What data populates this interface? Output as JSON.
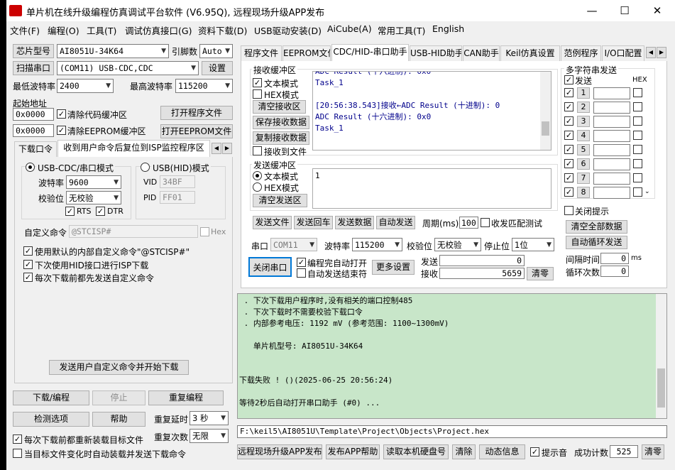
{
  "title": "单片机在线升级编程仿真调试平台软件 (V6.95Q), 远程现场升级APP发布",
  "menu": [
    "文件(F)",
    "编程(O)",
    "工具(T)",
    "调试仿真接口(G)",
    "资料下载(D)",
    "USB驱动安装(D)",
    "AiCube(A)",
    "常用工具(T)",
    "English"
  ],
  "left": {
    "chip_btn": "芯片型号",
    "chip_value": "AI8051U-34K64",
    "pins_label": "引脚数",
    "pins_value": "Auto",
    "scan_btn": "扫描串口",
    "port_value": "(COM11) USB-CDC,CDC",
    "settings_btn": "设置",
    "min_baud_label": "最低波特率",
    "min_baud_value": "2400",
    "max_baud_label": "最高波特率",
    "max_baud_value": "115200",
    "start_addr_label": "起始地址",
    "addr1": "0x0000",
    "clear_code": "清除代码缓冲区",
    "open_prog_btn": "打开程序文件",
    "addr2": "0x0000",
    "clear_eeprom": "清除EEPROM缓冲区",
    "open_eeprom_btn": "打开EEPROM文件",
    "tab1": "下载口令",
    "tab2": "收到用户命令后复位到ISP监控程序区",
    "usb_cdc_mode": "USB-CDC/串口模式",
    "usb_hid_mode": "USB(HID)模式",
    "baud_label": "波特率",
    "baud_value": "9600",
    "parity_label": "校验位",
    "parity_value": "无校验",
    "vid_label": "VID",
    "vid_value": "34BF",
    "pid_label": "PID",
    "pid_value": "FF01",
    "rts": "RTS",
    "dtr": "DTR",
    "custom_cmd_label": "自定义命令",
    "custom_cmd_value": "@STCISP#",
    "hex": "Hex",
    "opt1": "使用默认的内部自定义命令\"@STCISP#\"",
    "opt2": "下次使用HID接口进行ISP下载",
    "opt3": "每次下载前都先发送自定义命令",
    "send_custom_btn": "发送用户自定义命令并开始下载",
    "download_btn": "下载/编程",
    "stop_btn": "停止",
    "reprogram_btn": "重复编程",
    "check_btn": "检测选项",
    "help_btn": "帮助",
    "repeat_delay_label": "重复延时",
    "repeat_delay_value": "3 秒",
    "repeat_count_label": "重复次数",
    "repeat_count_value": "无限",
    "reload_opt": "每次下载前都重新装载目标文件",
    "auto_load_opt": "当目标文件变化时自动装载并发送下载命令"
  },
  "right": {
    "tabs": [
      "程序文件",
      "EEPROM文件",
      "CDC/HID-串口助手",
      "USB-HID助手",
      "CAN助手",
      "Keil仿真设置",
      "范例程序",
      "I/O口配置"
    ],
    "rx_group": "接收缓冲区",
    "rx_text_mode": "文本模式",
    "rx_hex_mode": "HEX模式",
    "clear_rx_btn": "清空接收区",
    "save_rx_btn": "保存接收数据",
    "copy_rx_btn": "复制接收数据",
    "rx_to_file": "接收到文件",
    "rx_lines": [
      "ADC Result (十六进制): 0x0",
      "Task_1",
      "",
      "[20:56:38.543]接收←ADC Result (十进制): 0",
      "ADC Result (十六进制): 0x0",
      "Task_1"
    ],
    "tx_group": "发送缓冲区",
    "tx_text_mode": "文本模式",
    "tx_hex_mode": "HEX模式",
    "clear_tx_btn": "清空发送区",
    "tx_content": "1",
    "send_file_btn": "发送文件",
    "send_enter_btn": "发送回车",
    "send_data_btn": "发送数据",
    "auto_send_btn": "自动发送",
    "period_label": "周期(ms)",
    "period_value": "100",
    "match_test": "收发匹配测试",
    "port_label": "串口",
    "port_value": "COM11",
    "baud_label": "波特率",
    "baud_value": "115200",
    "parity_label": "校验位",
    "parity_value": "无校验",
    "stop_label": "停止位",
    "stop_value": "1位",
    "close_port_btn": "关闭串口",
    "auto_open": "编程完自动打开",
    "auto_end": "自动发送结束符",
    "more_btn": "更多设置",
    "send_label": "发送",
    "send_count": "0",
    "recv_label": "接收",
    "recv_count": "5659",
    "clear_count_btn": "清零",
    "multi_group": "多字符串发送",
    "multi_send": "发送",
    "multi_hex": "HEX",
    "multi_rows": [
      "1",
      "2",
      "3",
      "4",
      "5",
      "6",
      "7",
      "8"
    ],
    "close_hint": "关闭提示",
    "clear_all_btn": "清空全部数据",
    "auto_loop_btn": "自动循环发送",
    "interval_label": "间隔时间",
    "interval_value": "0",
    "interval_unit": "ms",
    "loop_count_label": "循环次数",
    "loop_count_value": "0"
  },
  "log": {
    "lines": [
      " . 下次下载用户程序时,没有相关的端口控制485",
      " . 下次下载时不需要校验下载口令",
      " . 内部参考电压: 1192 mV (参考范围: 1100~1300mV)",
      "",
      "   单片机型号: AI8051U-34K64",
      "",
      "",
      "下载失败 ! ()(2025-06-25 20:56:24)",
      "",
      "等待2秒后自动打开串口助手 (#0) ..."
    ],
    "bg_color": "#c8e6c9"
  },
  "path": "F:\\keil5\\AI8051U\\Template\\Project\\Objects\\Project.hex",
  "bottom": {
    "publish_btn": "远程现场升级APP发布",
    "publish_help_btn": "发布APP帮助",
    "read_sn_btn": "读取本机硬盘号",
    "clear_btn": "清除",
    "dynamic_btn": "动态信息",
    "beep": "提示音",
    "success_label": "成功计数",
    "success_value": "525",
    "reset_btn": "清零"
  }
}
